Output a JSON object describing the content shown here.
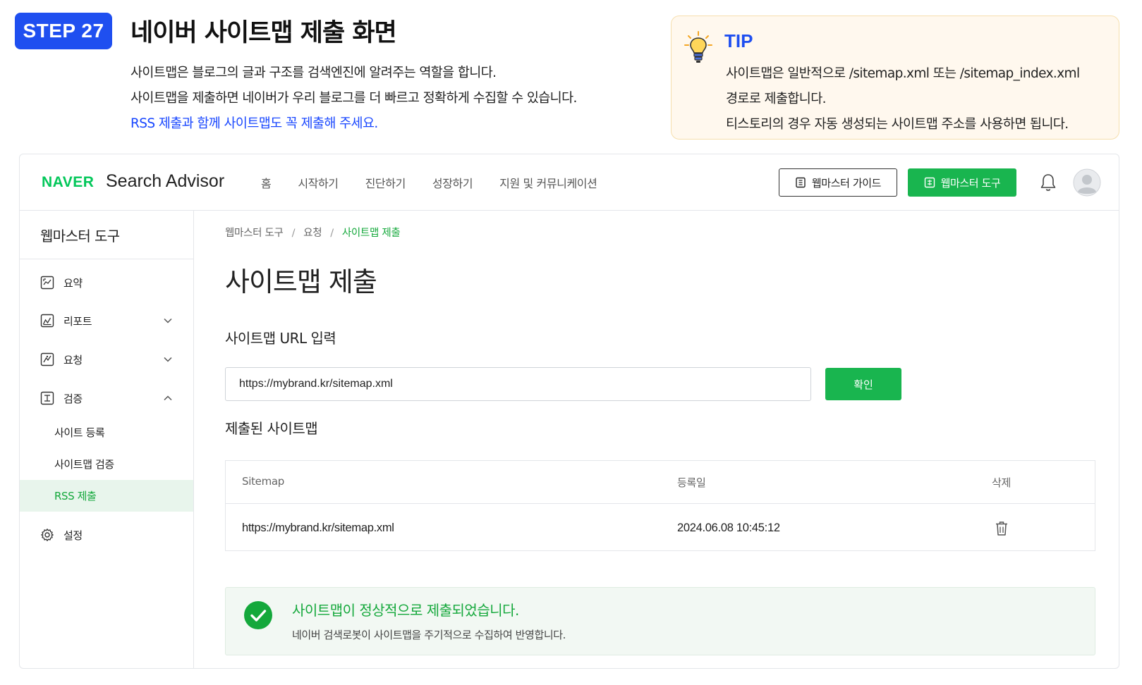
{
  "step": {
    "badge": "STEP 27",
    "title": "네이버 사이트맵 제출 화면",
    "desc_lines": [
      "사이트맵은 블로그의 글과 구조를 검색엔진에 알려주는 역할을 합니다.",
      "사이트맵을 제출하면 네이버가 우리 블로그를 더 빠르고 정확하게 수집할 수 있습니다."
    ],
    "highlight": "RSS 제출과 함께 사이트맵도 꼭 제출해 주세요."
  },
  "tip": {
    "title": "TIP",
    "lines": [
      "사이트맵은 일반적으로 /sitemap.xml 또는 /sitemap_index.xml",
      "경로로 제출합니다.",
      "티스토리의 경우 자동 생성되는 사이트맵 주소를 사용하면 됩니다."
    ],
    "icon": "lightbulb-icon"
  },
  "header": {
    "logo_naver": "NAVER",
    "logo_product": "Search Advisor",
    "menu": [
      "홈",
      "시작하기",
      "진단하기",
      "성장하기",
      "지원 및 커뮤니케이션"
    ],
    "guide_button": "웹마스터 가이드",
    "tool_button": "웹마스터 도구",
    "icons": [
      "bell-icon",
      "avatar"
    ]
  },
  "sidebar": {
    "title": "웹마스터 도구",
    "items": [
      {
        "label": "요약",
        "icon": "summary-icon"
      },
      {
        "label": "리포트",
        "icon": "report-icon",
        "expand": "chevron-down"
      },
      {
        "label": "요청",
        "icon": "request-icon",
        "expand": "chevron-down"
      },
      {
        "label": "검증",
        "icon": "verify-icon",
        "expand": "chevron-up"
      }
    ],
    "sub_items": [
      "사이트 등록",
      "사이트맵 검증",
      "RSS 제출"
    ],
    "active_sub": "RSS 제출",
    "settings": {
      "label": "설정",
      "icon": "gear-icon"
    }
  },
  "main": {
    "breadcrumb": [
      "웹마스터 도구",
      "요청",
      "사이트맵 제출"
    ],
    "breadcrumb_sep": "/",
    "page_title": "사이트맵 제출",
    "url_label": "사이트맵 URL 입력",
    "url_value": "https://mybrand.kr/sitemap.xml",
    "confirm_button": "확인",
    "submitted_label": "제출된 사이트맵",
    "table": {
      "headers": [
        "Sitemap",
        "등록일",
        "삭제"
      ],
      "rows": [
        {
          "sitemap": "https://mybrand.kr/sitemap.xml",
          "date": "2024.06.08 10:45:12",
          "action_icon": "trash-icon"
        }
      ]
    },
    "success": {
      "title": "사이트맵이 정상적으로 제출되었습니다.",
      "subtitle": "네이버 검색로봇이 사이트맵을 주기적으로 수집하여 반영합니다."
    }
  },
  "colors": {
    "step_blue": "#1f4ff0",
    "link_blue": "#1947ff",
    "naver_green": "#03c75a",
    "button_green": "#19b54f",
    "active_bg": "#e8f5ec",
    "tip_bg": "#fff8ee"
  }
}
